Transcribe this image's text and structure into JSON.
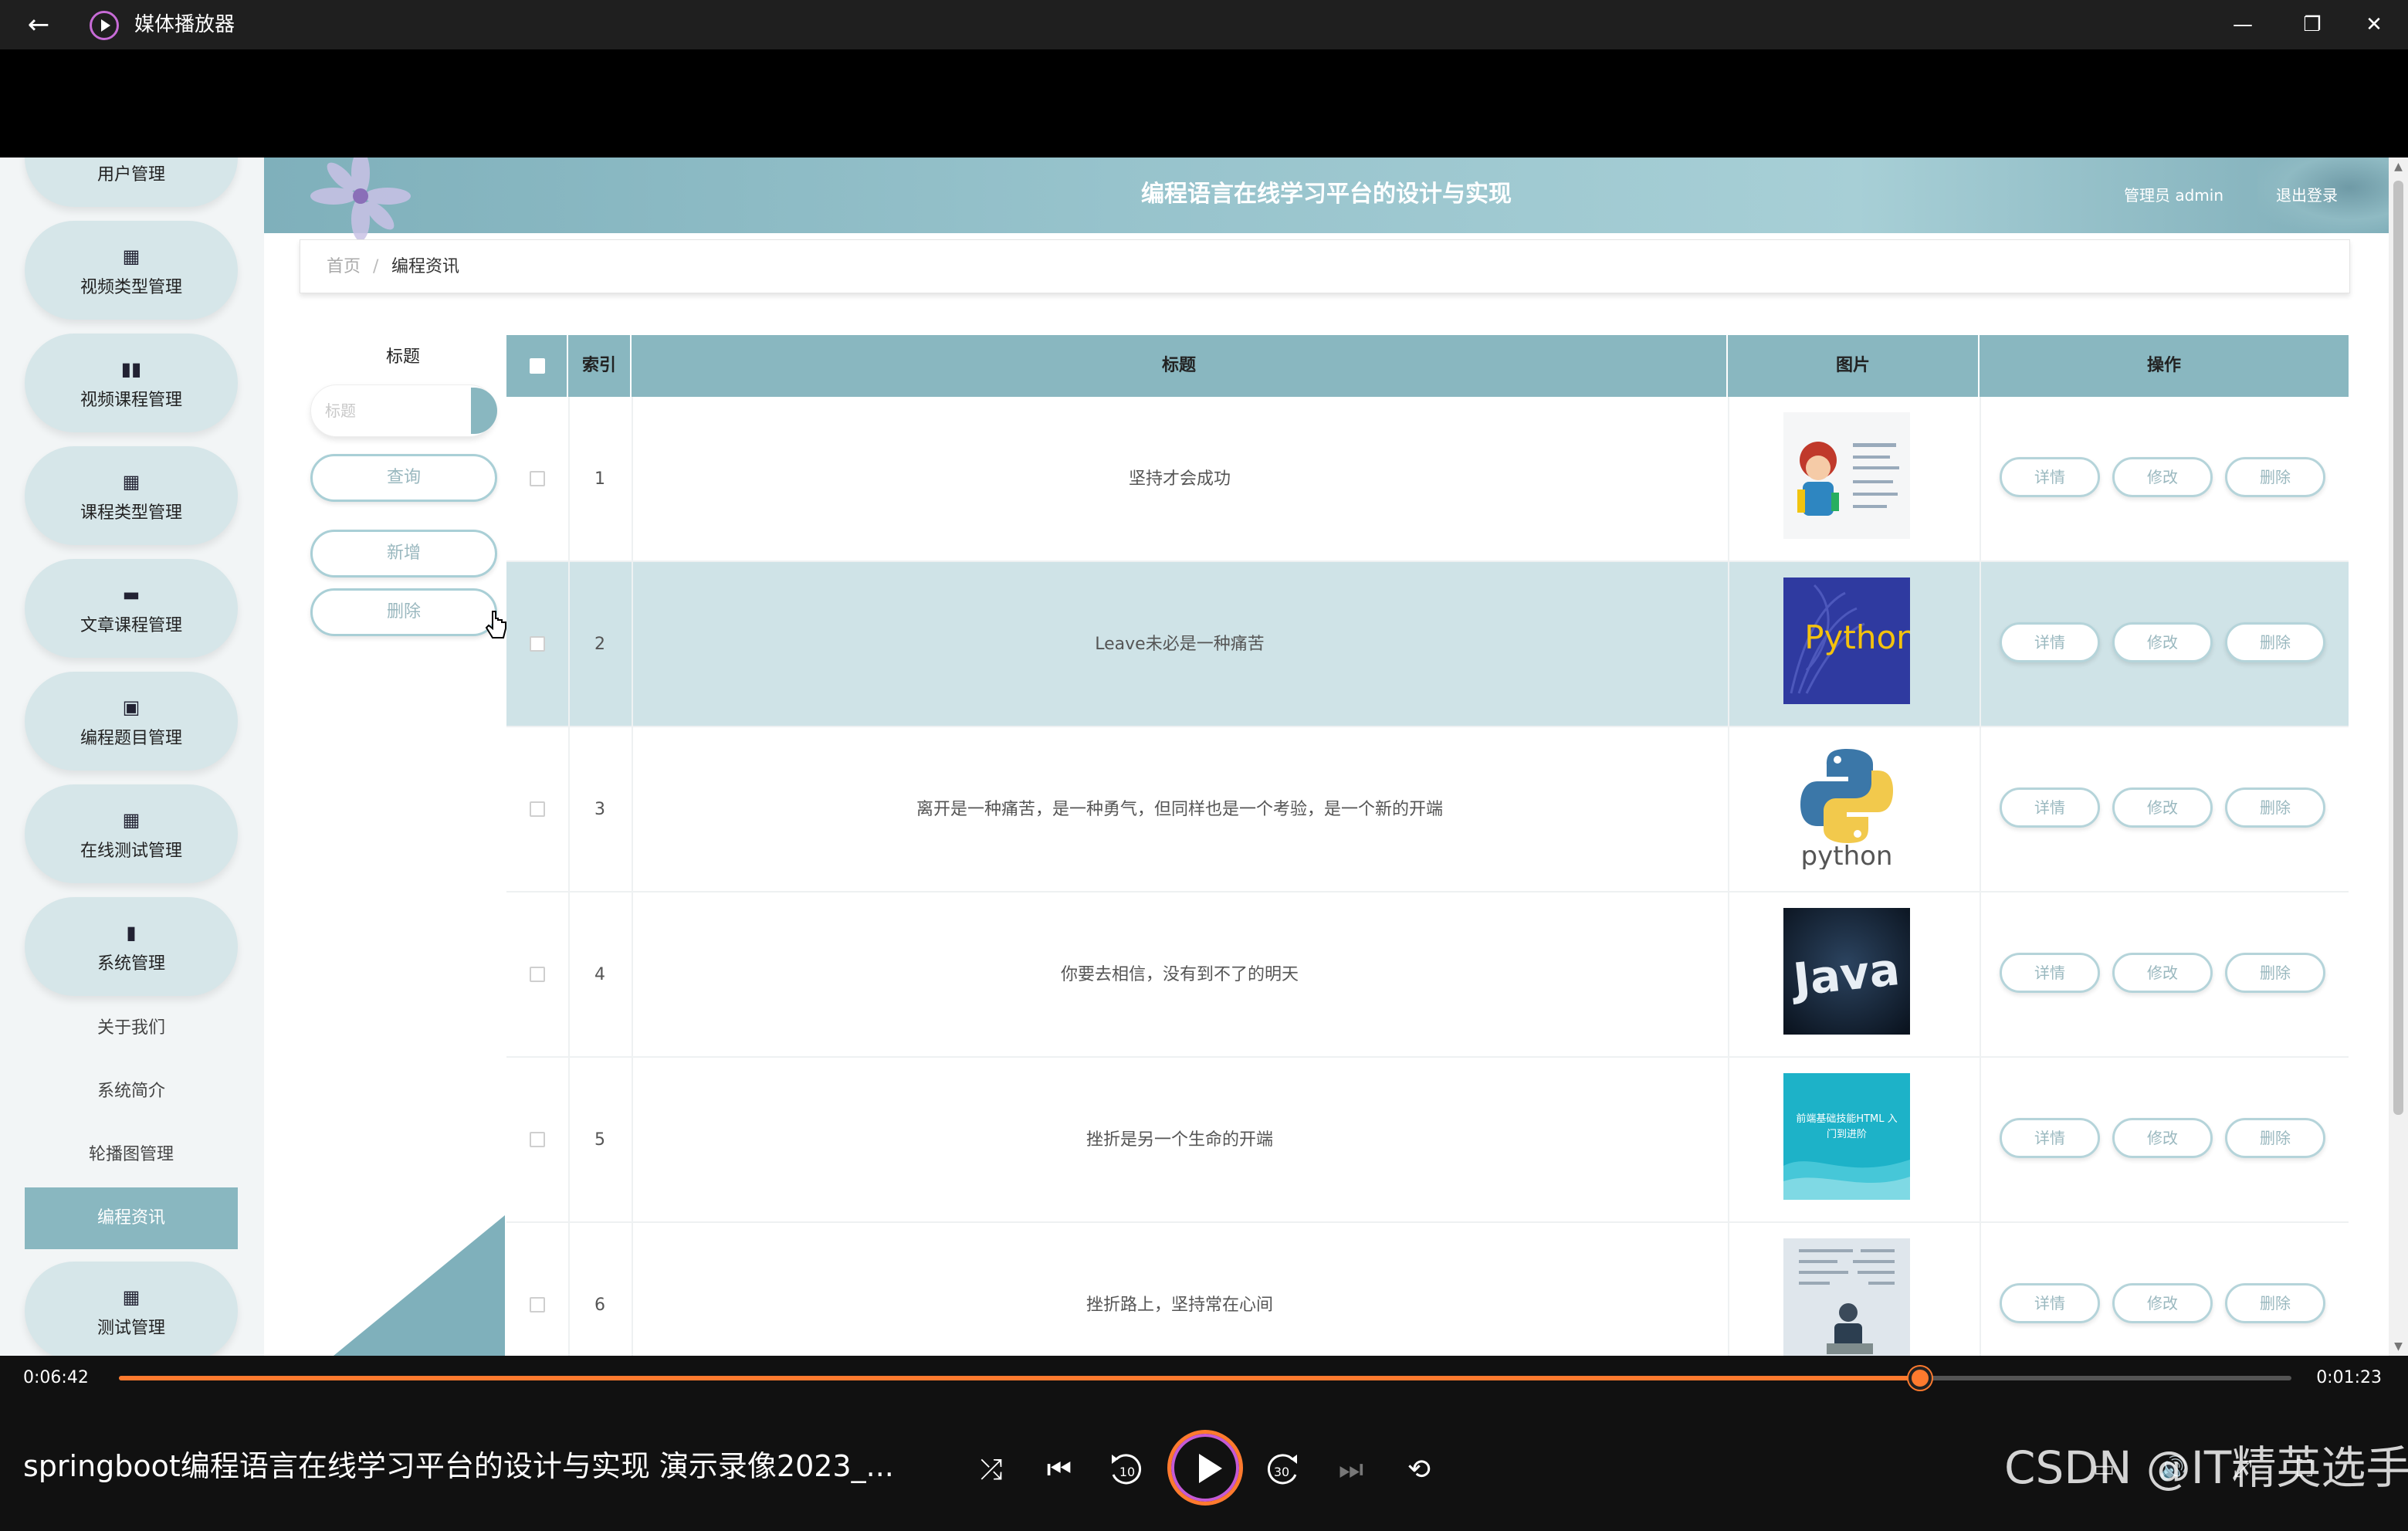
{
  "window": {
    "app_title": "媒体播放器",
    "back_icon": "←",
    "minimize_icon": "—",
    "restore_icon": "❐",
    "close_icon": "✕"
  },
  "header": {
    "site_title": "编程语言在线学习平台的设计与实现",
    "admin_label": "管理员 admin",
    "logout_label": "退出登录"
  },
  "sidebar": {
    "top_item": "用户管理",
    "items": [
      {
        "label": "视频类型管理",
        "icon": "▦"
      },
      {
        "label": "视频课程管理",
        "icon": "▮▮"
      },
      {
        "label": "课程类型管理",
        "icon": "▦"
      },
      {
        "label": "文章课程管理",
        "icon": "▬"
      },
      {
        "label": "编程题目管理",
        "icon": "▣"
      },
      {
        "label": "在线测试管理",
        "icon": "▦"
      },
      {
        "label": "系统管理",
        "icon": "▮"
      }
    ],
    "sub_items": [
      "关于我们",
      "系统简介",
      "轮播图管理",
      "编程资讯"
    ],
    "bottom_item": {
      "label": "测试管理",
      "icon": "▦"
    }
  },
  "breadcrumb": {
    "home": "首页",
    "separator": "/",
    "current": "编程资讯"
  },
  "search": {
    "label": "标题",
    "placeholder": "标题",
    "query_button": "查询",
    "add_button": "新增",
    "delete_button": "删除"
  },
  "table": {
    "columns": [
      "索引",
      "标题",
      "图片",
      "操作"
    ],
    "actions": [
      "详情",
      "修改",
      "删除"
    ],
    "rows": [
      {
        "index": "1",
        "title": "坚持才会成功",
        "image": "cartoon-infographic"
      },
      {
        "index": "2",
        "title": "Leave未必是一种痛苦",
        "image": "python-hand",
        "image_text": "Python"
      },
      {
        "index": "3",
        "title": "离开是一种痛苦，是一种勇气，但同样也是一个考验，是一个新的开端",
        "image": "python-logo",
        "image_text": "python"
      },
      {
        "index": "4",
        "title": "你要去相信，没有到不了的明天",
        "image": "java-logo",
        "image_text": "Java"
      },
      {
        "index": "5",
        "title": "挫折是另一个生命的开端",
        "image": "html-banner",
        "image_text": "前端基础技能HTML 入门到进阶"
      },
      {
        "index": "6",
        "title": "挫折路上，坚持常在心间",
        "image": "person-laptop-doc"
      }
    ]
  },
  "player": {
    "elapsed": "0:06:42",
    "remaining": "0:01:23",
    "progress_fraction": 0.829,
    "video_title": "springboot编程语言在线学习平台的设计与实现  演示录像2023_...",
    "skip_back_label": "10",
    "skip_forward_label": "30",
    "accent_color": "#ff7a2e"
  },
  "watermark": "CSDN @IT精英选手",
  "colors": {
    "header_teal": "#89b7c0",
    "sidebar_pill": "#d6e6e9",
    "row_highlight": "#cfe3e7"
  }
}
